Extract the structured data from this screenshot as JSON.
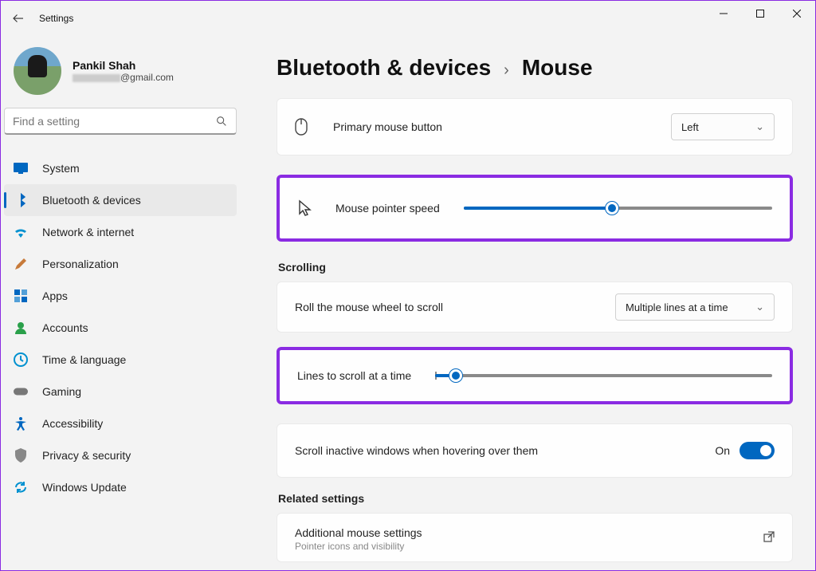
{
  "window": {
    "title": "Settings"
  },
  "profile": {
    "name": "Pankil Shah",
    "email_domain": "@gmail.com"
  },
  "search": {
    "placeholder": "Find a setting"
  },
  "nav": {
    "items": [
      {
        "label": "System"
      },
      {
        "label": "Bluetooth & devices"
      },
      {
        "label": "Network & internet"
      },
      {
        "label": "Personalization"
      },
      {
        "label": "Apps"
      },
      {
        "label": "Accounts"
      },
      {
        "label": "Time & language"
      },
      {
        "label": "Gaming"
      },
      {
        "label": "Accessibility"
      },
      {
        "label": "Privacy & security"
      },
      {
        "label": "Windows Update"
      }
    ],
    "selected_index": 1
  },
  "breadcrumb": {
    "parent": "Bluetooth & devices",
    "current": "Mouse"
  },
  "settings": {
    "primary_button": {
      "label": "Primary mouse button",
      "value": "Left"
    },
    "pointer_speed": {
      "label": "Mouse pointer speed",
      "percent": 48
    },
    "scrolling_header": "Scrolling",
    "roll_wheel": {
      "label": "Roll the mouse wheel to scroll",
      "value": "Multiple lines at a time"
    },
    "lines_scroll": {
      "label": "Lines to scroll at a time",
      "percent": 6
    },
    "inactive": {
      "label": "Scroll inactive windows when hovering over them",
      "state_label": "On",
      "on": true
    },
    "related_header": "Related settings",
    "additional": {
      "title": "Additional mouse settings",
      "sub": "Pointer icons and visibility"
    }
  }
}
